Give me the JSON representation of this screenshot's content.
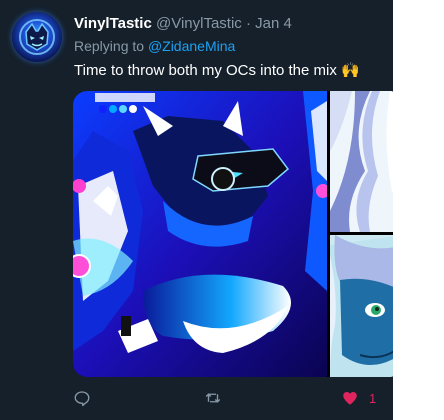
{
  "tweet": {
    "display_name": "VinylTastic",
    "handle": "@VinylTastic",
    "separator": "·",
    "date": "Jan 4",
    "replying_prefix": "Replying to",
    "replying_to": "@ZidaneMina",
    "text": "Time to throw both my OCs into the mix",
    "emoji": "🙌"
  },
  "actions": {
    "reply_icon": "reply-icon",
    "retweet_icon": "retweet-icon",
    "like_icon": "heart-icon",
    "like_count": "1"
  },
  "colors": {
    "background": "#15202b",
    "link": "#1da1f2",
    "like": "#e0245e",
    "muted": "#8899a6"
  }
}
